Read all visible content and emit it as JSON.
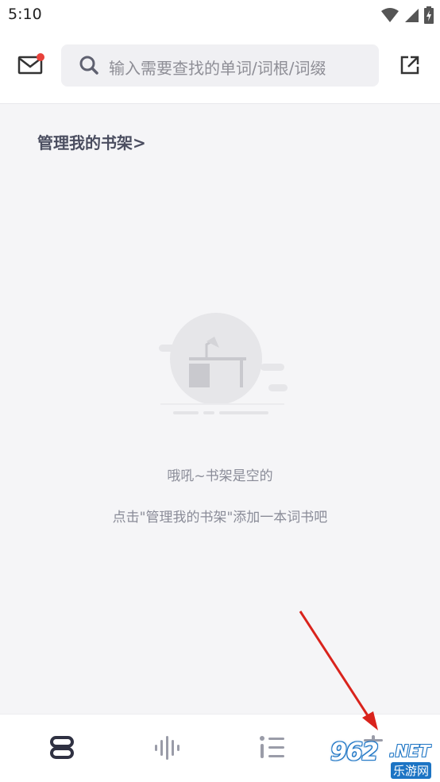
{
  "status_bar": {
    "time": "5:10",
    "icons": [
      "wifi-icon",
      "signal-icon",
      "battery-charging-icon"
    ]
  },
  "header": {
    "mail_icon": "mail-icon",
    "has_unread": true,
    "search_placeholder": "输入需要查找的单词/词根/词缀",
    "share_icon": "share-icon"
  },
  "bookshelf": {
    "manage_label": "管理我的书架>",
    "empty_title": "哦吼~书架是空的",
    "empty_hint": "点击\"管理我的书架\"添加一本词书吧"
  },
  "tabbar": {
    "tabs": [
      {
        "icon": "bookshelf-icon",
        "active": true
      },
      {
        "icon": "audio-wave-icon",
        "active": false
      },
      {
        "icon": "list-icon",
        "active": false
      },
      {
        "icon": "profile-icon",
        "active": false
      }
    ]
  },
  "watermark": {
    "number": "962",
    "domain": ".NET",
    "site": "乐游网"
  },
  "colors": {
    "accent_dot": "#e8413a",
    "text_dark": "#4b4e60",
    "text_muted": "#8a8c98",
    "arrow": "#d9231c"
  }
}
